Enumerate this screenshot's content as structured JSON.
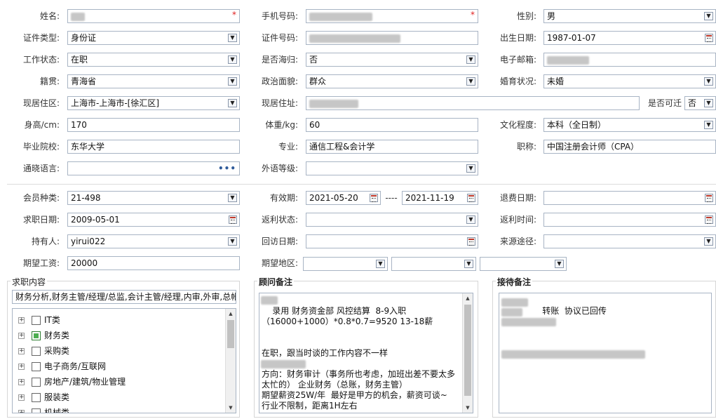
{
  "personal": {
    "name_label": "姓名:",
    "mobile_label": "手机号码:",
    "gender_label": "性别:",
    "gender_value": "男",
    "idtype_label": "证件类型:",
    "idtype_value": "身份证",
    "idno_label": "证件号码:",
    "birth_label": "出生日期:",
    "birth_value": "1987-01-07",
    "workstatus_label": "工作状态:",
    "workstatus_value": "在职",
    "overseas_label": "是否海归:",
    "overseas_value": "否",
    "email_label": "电子邮箱:",
    "native_label": "籍贯:",
    "native_value": "青海省",
    "political_label": "政治面貌:",
    "political_value": "群众",
    "marital_label": "婚育状况:",
    "marital_value": "未婚",
    "residence_label": "现居住区:",
    "residence_value": "上海市-上海市-[徐汇区]",
    "address_label": "现居住址:",
    "relocate_label": "是否可迁",
    "relocate_value": "否",
    "height_label": "身高/cm:",
    "height_value": "170",
    "weight_label": "体重/kg:",
    "weight_value": "60",
    "education_label": "文化程度:",
    "education_value": "本科（全日制）",
    "school_label": "毕业院校:",
    "school_value": "东华大学",
    "major_label": "专业:",
    "major_value": "通信工程&会计学",
    "title_label": "职称:",
    "title_value": "中国注册会计师（CPA）",
    "language_label": "通晓语言:",
    "foreign_label": "外语等级:"
  },
  "membership": {
    "type_label": "会员种类:",
    "type_value": "21-498",
    "valid_label": "有效期:",
    "valid_from": "2021-05-20",
    "valid_sep": "----",
    "valid_to": "2021-11-19",
    "refund_label": "退费日期:",
    "seek_label": "求职日期:",
    "seek_value": "2009-05-01",
    "rebate_status_label": "返利状态:",
    "rebate_time_label": "返利时间:",
    "holder_label": "持有人:",
    "holder_value": "yirui022",
    "visit_label": "回访日期:",
    "source_label": "来源途径:",
    "salary_label": "期望工资:",
    "salary_value": "20000",
    "region_label": "期望地区:"
  },
  "job_content": {
    "title": "求职内容",
    "summary": "财务分析,财务主管/经理/总监,会计主管/经理,内审,外审,总帐",
    "tree": [
      "IT类",
      "财务类",
      "采购类",
      "电子商务/互联网",
      "房地产/建筑/物业管理",
      "服装类",
      "机械类"
    ],
    "checked_index": 1
  },
  "advisor_note": {
    "title": "顾问备注",
    "text": "录用 财务资金部 风控结算  8-9入职\n（16000+1000）*0.8*0.7=9520 13-18薪\n\n\n在职，跟当时谈的工作内容不一样\n\n方向：财务审计（事务所也考虑，加班出差不要太多太忙的） 企业财务（总账，财务主管）\n期望薪资25W/年  最好是甲方的机会，薪资可谈~\n行业不限制，距离1H左右"
  },
  "reception_note": {
    "title": "接待备注",
    "text": "转账  协议已回传"
  },
  "colors": {
    "required": "#e02020",
    "border": "#a8b4c4",
    "accent": "#2f5b9a"
  }
}
